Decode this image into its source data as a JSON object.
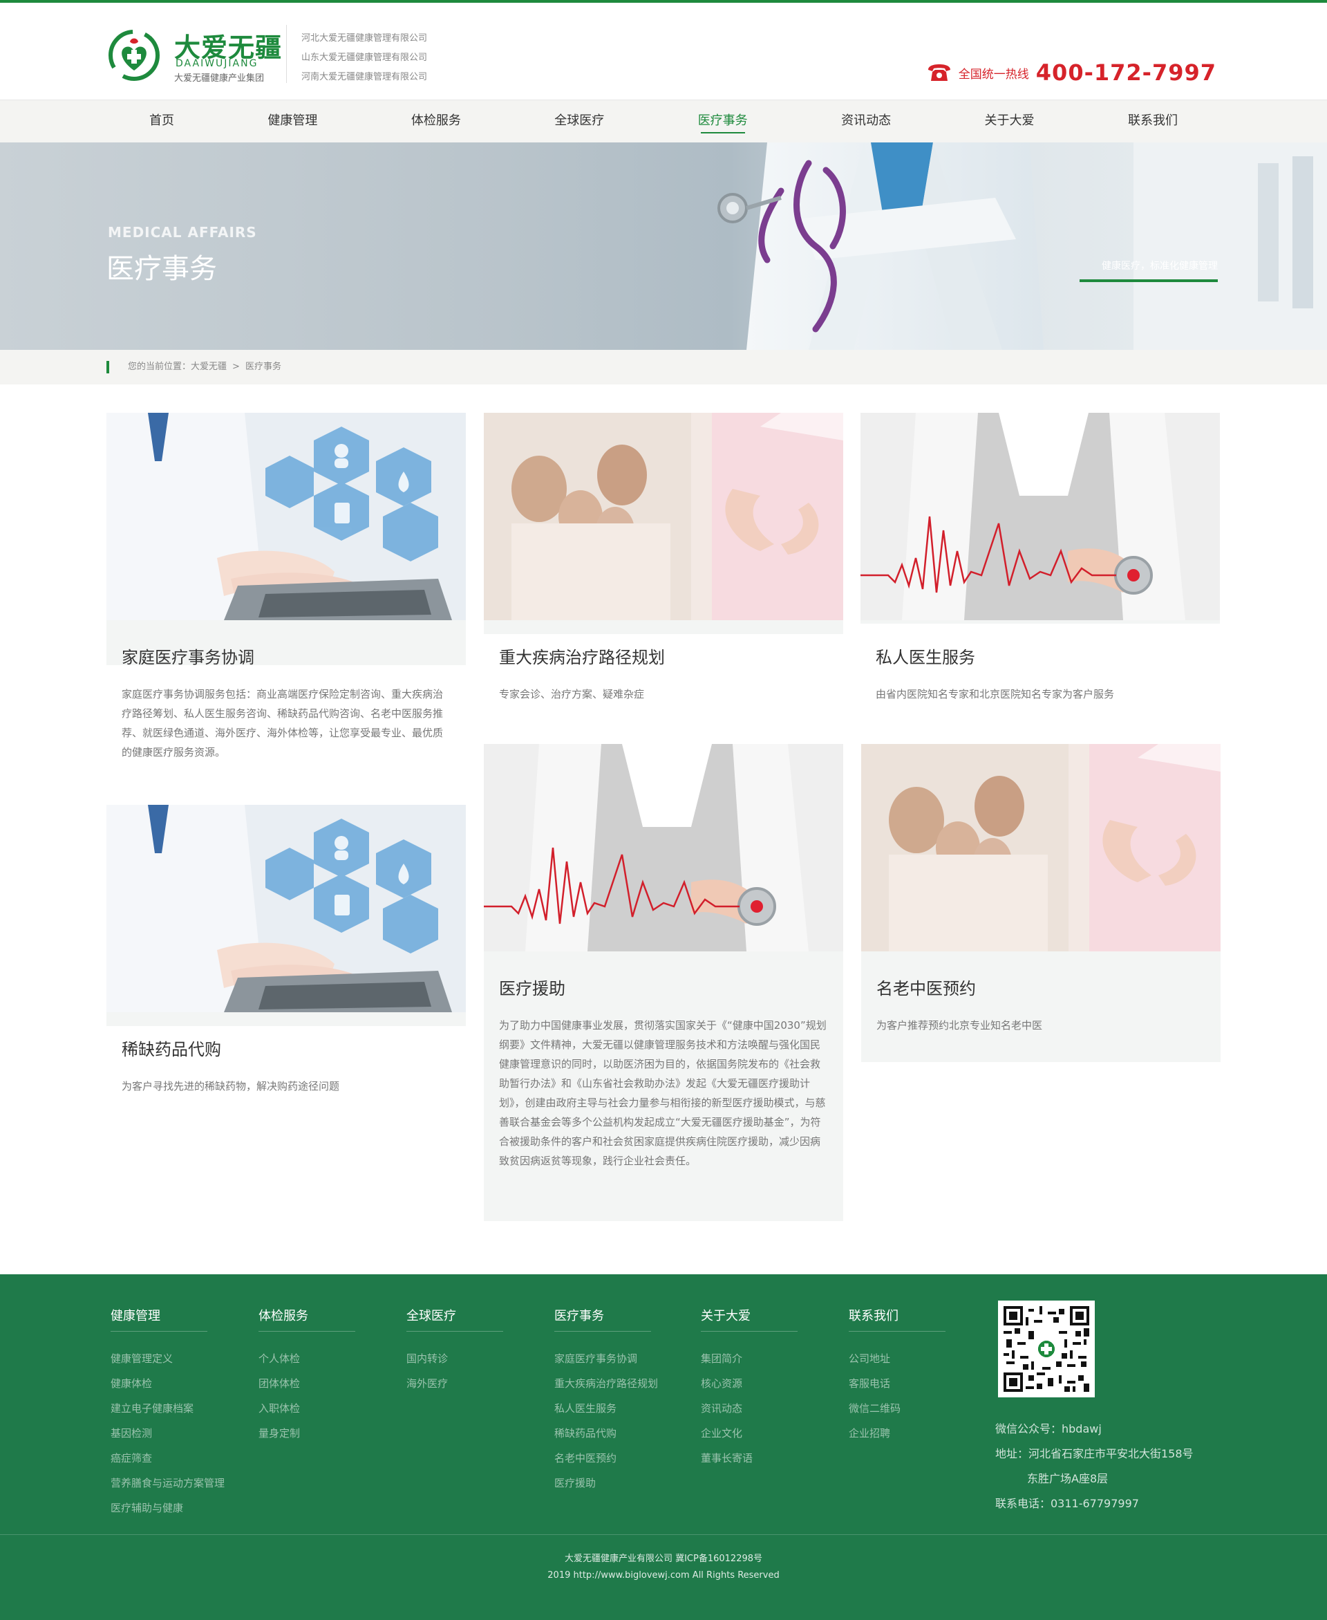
{
  "colors": {
    "brand_green": "#1e8a3d",
    "hotline_red": "#d6232a",
    "footer_green": "#1f7a4a"
  },
  "header": {
    "logo_cn": "大爱无疆",
    "logo_en": "DAAIWUJIANG",
    "logo_sub": "大爱无疆健康产业集团",
    "companies": [
      "河北大爱无疆健康管理有限公司",
      "山东大爱无疆健康管理有限公司",
      "河南大爱无疆健康管理有限公司"
    ],
    "hotline_label": "全国统一热线",
    "hotline_number": "400-172-7997",
    "phone_icon": "phone-icon"
  },
  "nav": {
    "items": [
      "首页",
      "健康管理",
      "体检服务",
      "全球医疗",
      "医疗事务",
      "资讯动态",
      "关于大爱",
      "联系我们"
    ],
    "active": "医疗事务"
  },
  "banner": {
    "title_en": "MEDICAL AFFAIRS",
    "title_cn": "医疗事务",
    "tagline": "健康医疗，标准化健康管理"
  },
  "breadcrumb": {
    "prefix": "您的当前位置：",
    "home": "大爱无疆",
    "separator": ">",
    "current": "医疗事务"
  },
  "cards": [
    {
      "title": "家庭医疗事务协调",
      "desc": "家庭医疗事务协调服务包括：商业高端医疗保险定制咨询、重大疾病治疗路径筹划、私人医生服务咨询、稀缺药品代购咨询、名老中医服务推荐、就医绿色通道、海外医疗、海外体检等，让您享受最专业、最优质的健康医疗服务资源。"
    },
    {
      "title": "重大疾病治疗路径规划",
      "desc": "专家会诊、治疗方案、疑难杂症"
    },
    {
      "title": "私人医生服务",
      "desc": "由省内医院知名专家和北京医院知名专家为客户服务"
    },
    {
      "title": "稀缺药品代购",
      "desc": "为客户寻找先进的稀缺药物，解决购药途径问题"
    },
    {
      "title": "医疗援助",
      "desc": "为了助力中国健康事业发展，贯彻落实国家关于《“健康中国2030”规划纲要》文件精神，大爱无疆以健康管理服务技术和方法唤醒与强化国民健康管理意识的同时，以助医济困为目的，依据国务院发布的《社会救助暂行办法》和《山东省社会救助办法》发起《大爱无疆医疗援助计划》，创建由政府主导与社会力量参与相衔接的新型医疗援助模式，与慈善联合基金会等多个公益机构发起成立“大爱无疆医疗援助基金”，为符合被援助条件的客户和社会贫困家庭提供疾病住院医疗援助，减少因病致贫因病返贫等现象，践行企业社会责任。"
    },
    {
      "title": "名老中医预约",
      "desc": "为客户推荐预约北京专业知名老中医"
    }
  ],
  "footer": {
    "columns": [
      {
        "title": "健康管理",
        "links": [
          "健康管理定义",
          "健康体检",
          "建立电子健康档案",
          "基因检测",
          "癌症筛查",
          "营养膳食与运动方案管理",
          "医疗辅助与健康"
        ]
      },
      {
        "title": "体检服务",
        "links": [
          "个人体检",
          "团体体检",
          "入职体检",
          "量身定制"
        ]
      },
      {
        "title": "全球医疗",
        "links": [
          "国内转诊",
          "海外医疗"
        ]
      },
      {
        "title": "医疗事务",
        "links": [
          "家庭医疗事务协调",
          "重大疾病治疗路径规划",
          "私人医生服务",
          "稀缺药品代购",
          "名老中医预约",
          "医疗援助"
        ]
      },
      {
        "title": "关于大爱",
        "links": [
          "集团简介",
          "核心资源",
          "资讯动态",
          "企业文化",
          "董事长寄语"
        ]
      },
      {
        "title": "联系我们",
        "links": [
          "公司地址",
          "客服电话",
          "微信二维码",
          "企业招聘"
        ]
      }
    ],
    "wechat": "微信公众号：hbdawj",
    "address_1": "地址：河北省石家庄市平安北大街158号",
    "address_2": "东胜广场A座8层",
    "phone": "联系电话：0311-67797997",
    "copyright_1": "大爱无疆健康产业有限公司 冀ICP备16012298号",
    "copyright_2": "2019 http://www.biglovewj.com All Rights Reserved"
  }
}
